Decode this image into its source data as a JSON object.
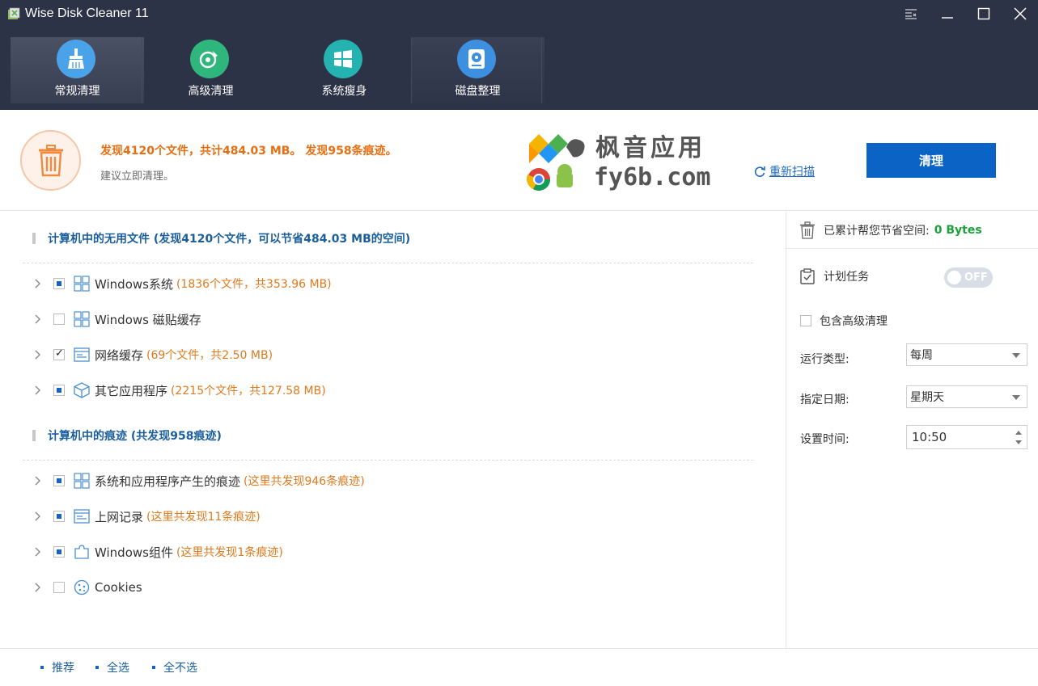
{
  "app": {
    "title": "Wise Disk Cleaner 11"
  },
  "nav": {
    "tabs": [
      {
        "label": "常规清理",
        "icon": "broom-icon",
        "color": "#4aa3e8"
      },
      {
        "label": "高级清理",
        "icon": "vinyl-icon",
        "color": "#2fb67c"
      },
      {
        "label": "系统瘦身",
        "icon": "windows-icon",
        "color": "#24b3b0"
      },
      {
        "label": "磁盘整理",
        "icon": "disk-icon",
        "color": "#3d8fe0"
      }
    ]
  },
  "summary": {
    "found": "发现4120个文件，共计484.03 MB。 发现958条痕迹。",
    "suggestion": "建议立即清理。",
    "watermark_top": "枫音应用",
    "watermark_bottom": "fy6b.com",
    "rescan": "重新扫描",
    "clean": "清理"
  },
  "sections": [
    {
      "title": "计算机中的无用文件 (发现4120个文件，可以节省484.03 MB的空间)",
      "items": [
        {
          "label": "Windows系统",
          "detail": "(1836个文件，共353.96 MB)",
          "state": "partial",
          "icon": "windows-tiles-icon"
        },
        {
          "label": "Windows 磁贴缓存",
          "detail": "",
          "state": "unchecked",
          "icon": "windows-tiles-icon"
        },
        {
          "label": "网络缓存",
          "detail": "(69个文件，共2.50 MB)",
          "state": "checked",
          "icon": "browser-window-icon"
        },
        {
          "label": "其它应用程序",
          "detail": "(2215个文件，共127.58 MB)",
          "state": "partial",
          "icon": "package-box-icon"
        }
      ]
    },
    {
      "title": "计算机中的痕迹 (共发现958痕迹)",
      "items": [
        {
          "label": "系统和应用程序产生的痕迹",
          "detail": "(这里共发现946条痕迹)",
          "state": "partial",
          "icon": "windows-tiles-icon"
        },
        {
          "label": "上网记录",
          "detail": "(这里共发现11条痕迹)",
          "state": "partial",
          "icon": "browser-window-icon"
        },
        {
          "label": "Windows组件",
          "detail": "(这里共发现1条痕迹)",
          "state": "partial",
          "icon": "puzzle-icon"
        },
        {
          "label": "Cookies",
          "detail": "",
          "state": "unchecked",
          "icon": "cookie-icon"
        }
      ]
    }
  ],
  "right_panel": {
    "saved_label": "已累计帮您节省空间:",
    "saved_value": "0 Bytes",
    "schedule_label": "计划任务",
    "toggle_text": "OFF",
    "include_advanced": "包含高级清理",
    "run_type_label": "运行类型:",
    "run_type_value": "每周",
    "date_label": "指定日期:",
    "date_value": "星期天",
    "time_label": "设置时间:",
    "time_value": "10:50"
  },
  "footer": {
    "links": [
      "推荐",
      "全选",
      "全不选"
    ]
  }
}
